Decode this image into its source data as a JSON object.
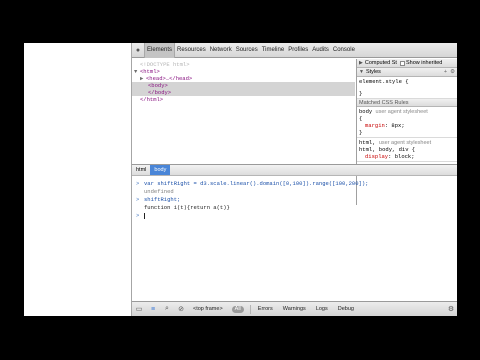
{
  "toolbar": {
    "tabs": [
      {
        "label": "Elements",
        "active": true
      },
      {
        "label": "Resources",
        "active": false
      },
      {
        "label": "Network",
        "active": false
      },
      {
        "label": "Sources",
        "active": false
      },
      {
        "label": "Timeline",
        "active": false
      },
      {
        "label": "Profiles",
        "active": false
      },
      {
        "label": "Audits",
        "active": false
      },
      {
        "label": "Console",
        "active": false
      }
    ],
    "close_icon": "close-icon",
    "inspect_icon": "magnifier-icon"
  },
  "elements": {
    "lines": [
      "<!DOCTYPE html>",
      "<html>",
      "<head>…</head>",
      "<body>",
      "</body>",
      "</html>"
    ]
  },
  "sidebar": {
    "computed_label": "Computed St",
    "show_inherited": "Show inherited",
    "styles_label": "Styles",
    "element_style": "element.style {",
    "close_brace": "}",
    "matched_rules": "Matched CSS Rules",
    "rule1_selector": "body",
    "rule1_source": "user agent stylesheet",
    "rule1_prop": "margin",
    "rule1_value": "8px;",
    "rule2_selector": "html, body, div {",
    "rule2_html": "html,",
    "rule2_source": "user agent stylesheet",
    "rule2_prop": "display",
    "rule2_value": "block;"
  },
  "breadcrumbs": [
    "html",
    "body"
  ],
  "console": {
    "input1": "var shiftRight = d3.scale.linear().domain([0,100]).range([100,200]);",
    "output1": "undefined",
    "input2": "shiftRight;",
    "output2": "function i(t){return a(t)}"
  },
  "statusbar": {
    "frame": "<top frame>",
    "all": "All",
    "filters": [
      "Errors",
      "Warnings",
      "Logs",
      "Debug"
    ]
  },
  "colors": {
    "tag": "#881280",
    "selection": "#d4d4d4",
    "breadcrumb_active": "#4a86d8"
  }
}
